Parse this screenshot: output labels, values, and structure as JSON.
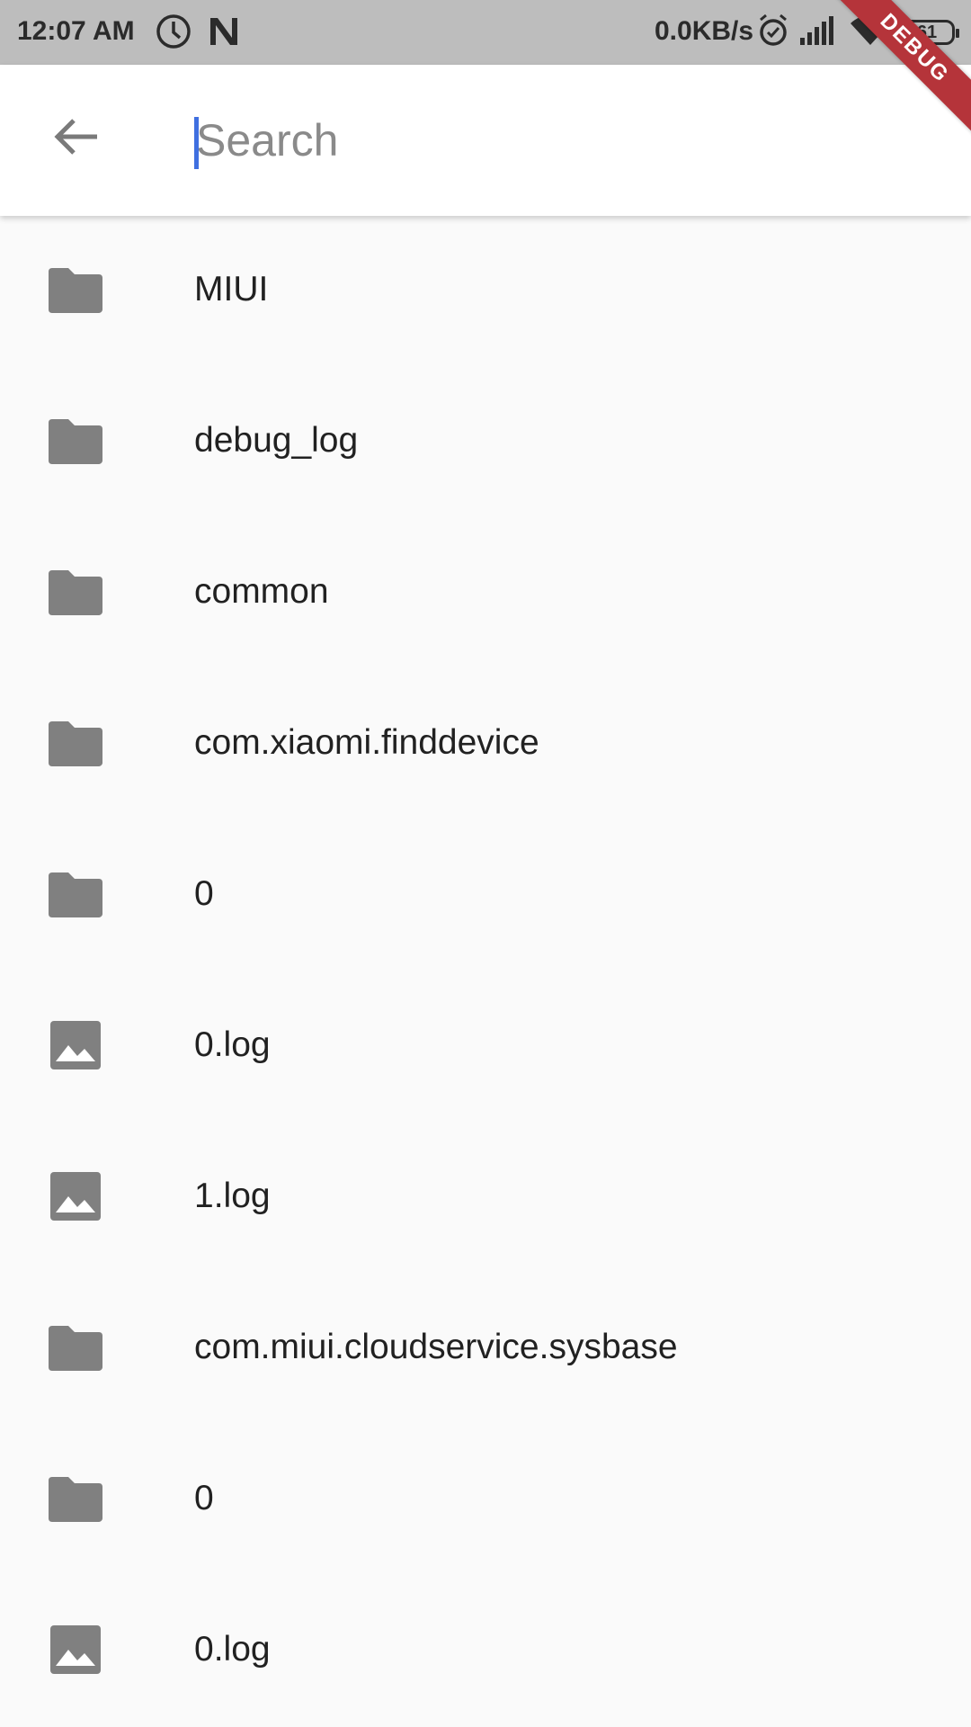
{
  "status_bar": {
    "time": "12:07 AM",
    "network_speed": "0.0KB/s",
    "battery": "61",
    "icons": [
      "clock-icon",
      "n-icon",
      "alarm-icon",
      "signal-icon",
      "wifi-icon",
      "battery-icon"
    ]
  },
  "debug_banner": "DEBUG",
  "search": {
    "placeholder": "Search",
    "value": "",
    "back_icon": "arrow-back-icon"
  },
  "files": [
    {
      "name": "MIUI",
      "type": "folder"
    },
    {
      "name": "debug_log",
      "type": "folder"
    },
    {
      "name": "common",
      "type": "folder"
    },
    {
      "name": "com.xiaomi.finddevice",
      "type": "folder"
    },
    {
      "name": "0",
      "type": "folder"
    },
    {
      "name": "0.log",
      "type": "image"
    },
    {
      "name": "1.log",
      "type": "image"
    },
    {
      "name": "com.miui.cloudservice.sysbase",
      "type": "folder"
    },
    {
      "name": "0",
      "type": "folder"
    },
    {
      "name": "0.log",
      "type": "image"
    }
  ],
  "colors": {
    "icon": "#808080",
    "ribbon": "#b5343a",
    "caret": "#3f6fe0"
  }
}
